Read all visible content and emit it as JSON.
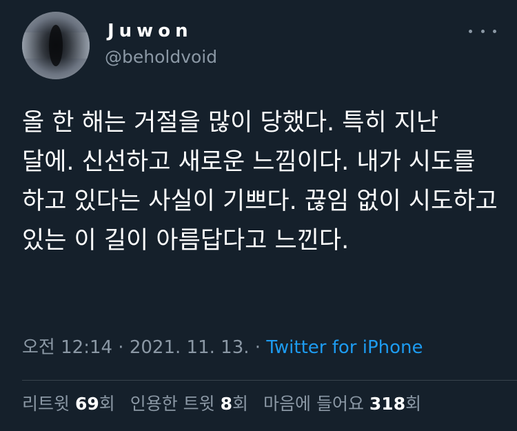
{
  "user": {
    "display_name": "Juwon",
    "handle": "@beholdvoid",
    "avatar_icon": "avatar-image"
  },
  "menu_icon": "more-horizontal-icon",
  "tweet": {
    "text": "올 한 해는 거절을 많이 당했다. 특히 지난 달에. 신선하고 새로운 느낌이다. 내가 시도를 하고 있다는 사실이 기쁘다. 끊임 없이 시도하고 있는 이 길이 아름답다고 느낀다."
  },
  "meta": {
    "time": "오전 12:14",
    "separator1": " · ",
    "date": "2021. 11. 13.",
    "separator2": " · ",
    "source": "Twitter for iPhone"
  },
  "stats": {
    "retweets": {
      "label": "리트윗 ",
      "count": "69",
      "suffix": "회"
    },
    "quotes": {
      "label": "인용한 트윗 ",
      "count": "8",
      "suffix": "회"
    },
    "likes": {
      "label": "마음에 들어요 ",
      "count": "318",
      "suffix": "회"
    }
  },
  "colors": {
    "background": "#15202b",
    "primary_text": "#ffffff",
    "secondary_text": "#8b98a5",
    "link": "#1d9bf0",
    "divider": "#38444d"
  }
}
